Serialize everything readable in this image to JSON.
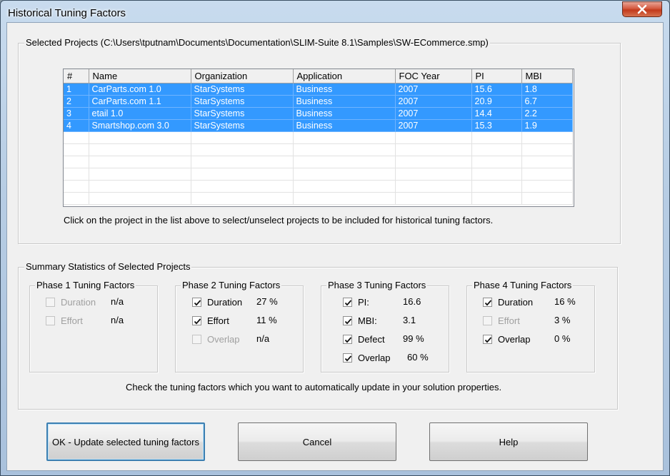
{
  "window": {
    "title": "Historical Tuning Factors"
  },
  "projects_group": {
    "legend": "Selected Projects (C:\\Users\\tputnam\\Documents\\Documentation\\SLIM-Suite 8.1\\Samples\\SW-ECommerce.smp)",
    "columns": [
      "#",
      "Name",
      "Organization",
      "Application",
      "FOC Year",
      "PI",
      "MBI"
    ],
    "rows": [
      [
        "1",
        "CarParts.com 1.0",
        "StarSystems",
        "Business",
        "2007",
        "15.6",
        "1.8"
      ],
      [
        "2",
        "CarParts.com 1.1",
        "StarSystems",
        "Business",
        "2007",
        "20.9",
        "6.7"
      ],
      [
        "3",
        "etail 1.0",
        "StarSystems",
        "Business",
        "2007",
        "14.4",
        "2.2"
      ],
      [
        "4",
        "Smartshop.com 3.0",
        "StarSystems",
        "Business",
        "2007",
        "15.3",
        "1.9"
      ]
    ],
    "hint": "Click on the project in the list above to select/unselect projects to be included for historical tuning factors."
  },
  "summary_group": {
    "legend": "Summary Statistics of Selected Projects",
    "phase1": {
      "legend": "Phase 1 Tuning Factors",
      "duration_label": "Duration",
      "duration_value": "n/a",
      "duration_checked": false,
      "duration_enabled": false,
      "effort_label": "Effort",
      "effort_value": "n/a",
      "effort_checked": false,
      "effort_enabled": false
    },
    "phase2": {
      "legend": "Phase 2 Tuning Factors",
      "duration_label": "Duration",
      "duration_value": "27 %",
      "duration_checked": true,
      "effort_label": "Effort",
      "effort_value": "11 %",
      "effort_checked": true,
      "overlap_label": "Overlap",
      "overlap_value": "n/a",
      "overlap_checked": false,
      "overlap_enabled": false
    },
    "phase3": {
      "legend": "Phase 3 Tuning Factors",
      "pi_label": "PI:",
      "pi_value": "16.6",
      "pi_checked": true,
      "mbi_label": "MBI:",
      "mbi_value": "3.1",
      "mbi_checked": true,
      "defect_label": "Defect",
      "defect_value": "99 %",
      "defect_checked": true,
      "overlap_label": "Overlap",
      "overlap_value": "60 %",
      "overlap_checked": true
    },
    "phase4": {
      "legend": "Phase 4 Tuning Factors",
      "duration_label": "Duration",
      "duration_value": "16 %",
      "duration_checked": true,
      "effort_label": "Effort",
      "effort_value": "3 %",
      "effort_checked": false,
      "effort_enabled": false,
      "overlap_label": "Overlap",
      "overlap_value": "0 %",
      "overlap_checked": true
    },
    "hint": "Check the tuning factors which you want to automatically update in your solution properties."
  },
  "buttons": {
    "ok_label": "OK - Update selected tuning factors",
    "cancel_label": "Cancel",
    "help_label": "Help"
  },
  "colors": {
    "selection": "#3399ff",
    "close_button": "#c23a1c"
  },
  "icons": {
    "close": "close-icon",
    "check": "checkmark-icon"
  }
}
